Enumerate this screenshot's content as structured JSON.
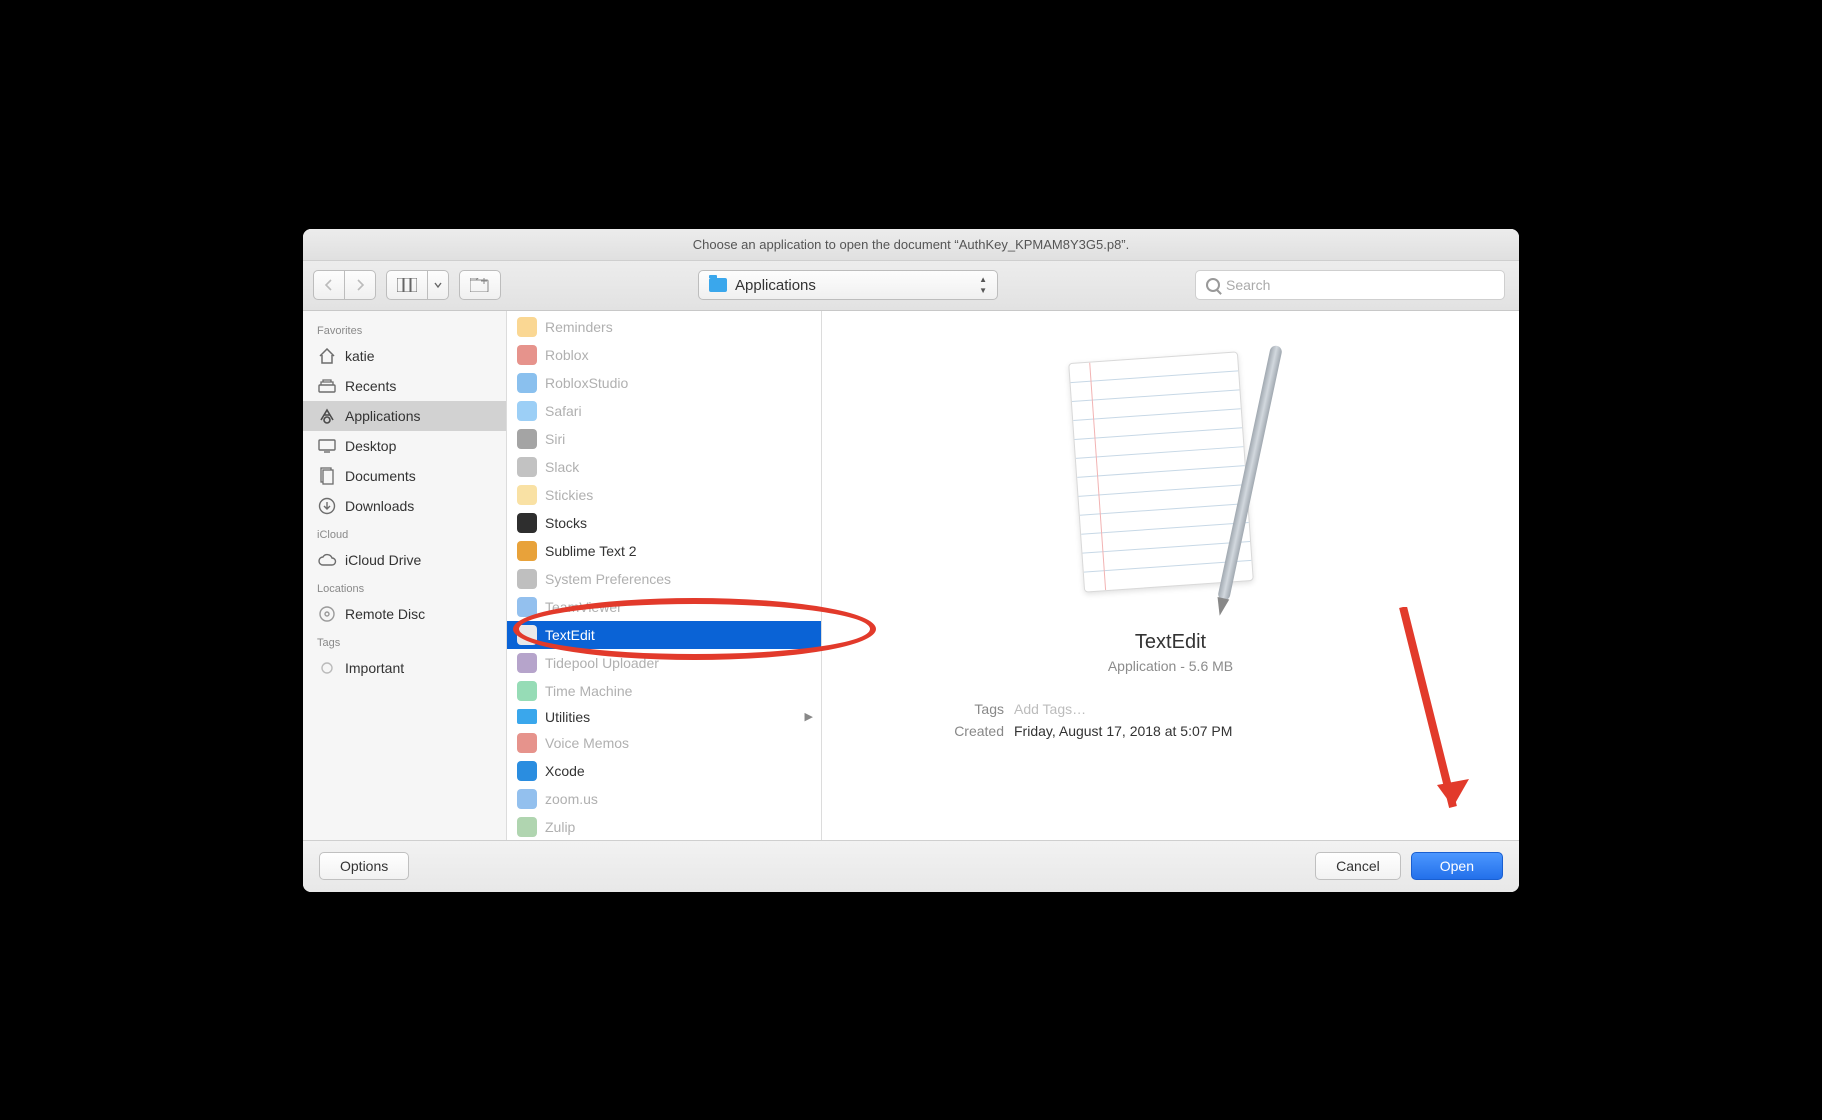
{
  "titlebar": {
    "text": "Choose an application to open the document “AuthKey_KPMAM8Y3G5.p8”."
  },
  "toolbar": {
    "path_label": "Applications",
    "search_placeholder": "Search"
  },
  "sidebar": {
    "favorites_heading": "Favorites",
    "favorites": [
      {
        "label": "katie",
        "icon": "home"
      },
      {
        "label": "Recents",
        "icon": "recents"
      },
      {
        "label": "Applications",
        "icon": "apps",
        "selected": true
      },
      {
        "label": "Desktop",
        "icon": "desktop"
      },
      {
        "label": "Documents",
        "icon": "docs"
      },
      {
        "label": "Downloads",
        "icon": "downloads"
      }
    ],
    "icloud_heading": "iCloud",
    "icloud": [
      {
        "label": "iCloud Drive",
        "icon": "cloud"
      }
    ],
    "locations_heading": "Locations",
    "locations": [
      {
        "label": "Remote Disc",
        "icon": "disc"
      }
    ],
    "tags_heading": "Tags",
    "tags": [
      {
        "label": "Important",
        "icon": "tagdot"
      }
    ]
  },
  "apps": [
    {
      "label": "Reminders",
      "dim": true,
      "color": "#f5b63b"
    },
    {
      "label": "Roblox",
      "dim": true,
      "color": "#d23a2e"
    },
    {
      "label": "RobloxStudio",
      "dim": true,
      "color": "#2a8de0"
    },
    {
      "label": "Safari",
      "dim": true,
      "color": "#4aa7ee"
    },
    {
      "label": "Siri",
      "dim": true,
      "color": "#5a5a5a"
    },
    {
      "label": "Slack",
      "dim": true,
      "color": "#8f8f8f"
    },
    {
      "label": "Stickies",
      "dim": true,
      "color": "#f4c95a"
    },
    {
      "label": "Stocks",
      "dim": false,
      "color": "#2e2e2e"
    },
    {
      "label": "Sublime Text 2",
      "dim": false,
      "color": "#e8a23a"
    },
    {
      "label": "System Preferences",
      "dim": true,
      "color": "#8a8a8a"
    },
    {
      "label": "TeamViewer",
      "dim": true,
      "color": "#3a8de0"
    },
    {
      "label": "TextEdit",
      "dim": false,
      "color": "#e9e9e9",
      "selected": true
    },
    {
      "label": "Tidepool Uploader",
      "dim": true,
      "color": "#7a5aa0"
    },
    {
      "label": "Time Machine",
      "dim": true,
      "color": "#3fbf7a"
    },
    {
      "label": "Utilities",
      "dim": false,
      "color": "#3aa7ec",
      "folder": true
    },
    {
      "label": "Voice Memos",
      "dim": true,
      "color": "#d23a2e"
    },
    {
      "label": "Xcode",
      "dim": false,
      "color": "#2a8de0"
    },
    {
      "label": "zoom.us",
      "dim": true,
      "color": "#3a8de0"
    },
    {
      "label": "Zulip",
      "dim": true,
      "color": "#6fb36f"
    }
  ],
  "preview": {
    "title": "TextEdit",
    "subtitle": "Application - 5.6 MB",
    "tags_label": "Tags",
    "tags_value": "Add Tags…",
    "created_label": "Created",
    "created_value": "Friday, August 17, 2018 at 5:07 PM"
  },
  "footer": {
    "options": "Options",
    "cancel": "Cancel",
    "open": "Open"
  }
}
